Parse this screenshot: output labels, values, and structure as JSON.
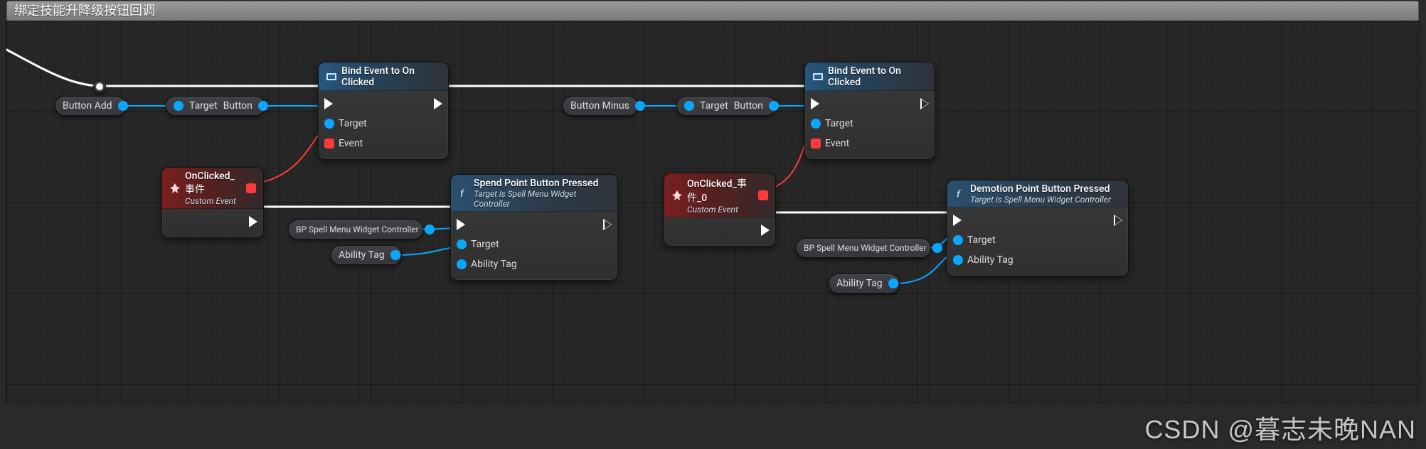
{
  "comment": {
    "title": "绑定技能升降级按钮回调"
  },
  "pills": {
    "buttonAdd": {
      "label": "Button Add"
    },
    "targetButton1": {
      "lblTarget": "Target",
      "lblButton": "Button"
    },
    "controller1": {
      "label": "BP Spell Menu Widget Controller"
    },
    "abilityTag1": {
      "label": "Ability Tag"
    },
    "buttonMinus": {
      "label": "Button Minus"
    },
    "targetButton2": {
      "lblTarget": "Target",
      "lblButton": "Button"
    },
    "controller2": {
      "label": "BP Spell Menu Widget Controller"
    },
    "abilityTag2": {
      "label": "Ability Tag"
    }
  },
  "nodes": {
    "bind1": {
      "title": "Bind Event to On Clicked",
      "pinTarget": "Target",
      "pinEvent": "Event"
    },
    "onclick1": {
      "title": "OnClicked_事件",
      "subtitle": "Custom Event"
    },
    "spend": {
      "title": "Spend Point Button Pressed",
      "subtitle": "Target is Spell Menu Widget Controller",
      "pinTarget": "Target",
      "pinAbility": "Ability Tag"
    },
    "bind2": {
      "title": "Bind Event to On Clicked",
      "pinTarget": "Target",
      "pinEvent": "Event"
    },
    "onclick2": {
      "title": "OnClicked_事件_0",
      "subtitle": "Custom Event"
    },
    "demotion": {
      "title": "Demotion Point Button Pressed",
      "subtitle": "Target is Spell Menu Widget Controller",
      "pinTarget": "Target",
      "pinAbility": "Ability Tag"
    }
  },
  "watermark": "CSDN @暮志未晚NAN",
  "colors": {
    "exec": "#ffffff",
    "object": "#0aa7ff",
    "delegate": "#ff3a3a",
    "struct": "#0aa7ff"
  }
}
